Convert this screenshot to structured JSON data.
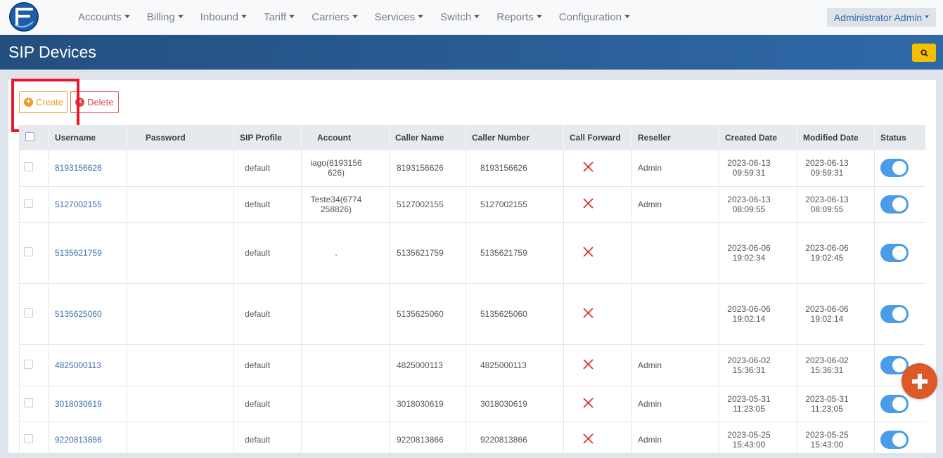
{
  "nav": {
    "items": [
      {
        "label": "Accounts"
      },
      {
        "label": "Billing"
      },
      {
        "label": "Inbound"
      },
      {
        "label": "Tariff"
      },
      {
        "label": "Carriers"
      },
      {
        "label": "Services"
      },
      {
        "label": "Switch"
      },
      {
        "label": "Reports"
      },
      {
        "label": "Configuration"
      }
    ],
    "user": "Administrator Admin"
  },
  "page": {
    "title": "SIP Devices"
  },
  "toolbar": {
    "create_label": "Create",
    "delete_label": "Delete"
  },
  "table": {
    "columns": [
      "Username",
      "Password",
      "SIP Profile",
      "Account",
      "Caller Name",
      "Caller Number",
      "Call Forward",
      "Reseller",
      "Created Date",
      "Modified Date",
      "Status"
    ],
    "rows": [
      {
        "username": "8193156626",
        "password": "",
        "sip_profile": "default",
        "account": "iago(8193156626)",
        "caller_name": "8193156626",
        "caller_number": "8193156626",
        "call_forward": "x",
        "reseller": "Admin",
        "created": "2023-06-13 09:59:31",
        "modified": "2023-06-13 09:59:31",
        "status": true
      },
      {
        "username": "5127002155",
        "password": "",
        "sip_profile": "default",
        "account": "Teste34(6774258826)",
        "caller_name": "5127002155",
        "caller_number": "5127002155",
        "call_forward": "x",
        "reseller": "Admin",
        "created": "2023-06-13 08:09:55",
        "modified": "2023-06-13 08:09:55",
        "status": true
      },
      {
        "username": "5135621759",
        "password": "",
        "sip_profile": "default",
        "account": ".",
        "caller_name": "5135621759",
        "caller_number": "5135621759",
        "call_forward": "x",
        "reseller": "",
        "created": "2023-06-06 19:02:34",
        "modified": "2023-06-06 19:02:45",
        "status": true
      },
      {
        "username": "5135625060",
        "password": "",
        "sip_profile": "default",
        "account": "",
        "caller_name": "5135625060",
        "caller_number": "5135625060",
        "call_forward": "x",
        "reseller": "",
        "created": "2023-06-06 19:02:14",
        "modified": "2023-06-06 19:02:14",
        "status": true
      },
      {
        "username": "4825000113",
        "password": "",
        "sip_profile": "default",
        "account": "",
        "caller_name": "4825000113",
        "caller_number": "4825000113",
        "call_forward": "x",
        "reseller": "Admin",
        "created": "2023-06-02 15:36:31",
        "modified": "2023-06-02 15:36:31",
        "status": true
      },
      {
        "username": "3018030619",
        "password": "",
        "sip_profile": "default",
        "account": "",
        "caller_name": "3018030619",
        "caller_number": "3018030619",
        "call_forward": "x",
        "reseller": "Admin",
        "created": "2023-05-31 11:23:05",
        "modified": "2023-05-31 11:23:05",
        "status": true
      },
      {
        "username": "9220813866",
        "password": "",
        "sip_profile": "default",
        "account": "",
        "caller_name": "9220813866",
        "caller_number": "9220813866",
        "call_forward": "x",
        "reseller": "Admin",
        "created": "2023-05-25 15:43:00",
        "modified": "2023-05-25 15:43:00",
        "status": true
      }
    ]
  },
  "colors": {
    "accent": "#2f69a8",
    "create": "#f0962a",
    "delete": "#e04848",
    "toggle": "#4a9be8",
    "fab": "#dc5a28",
    "highlight": "#e8192c"
  },
  "icons": {
    "logo": "brand-logo",
    "search": "search-icon",
    "fab": "plus-icon",
    "call_forward": "x-icon"
  }
}
